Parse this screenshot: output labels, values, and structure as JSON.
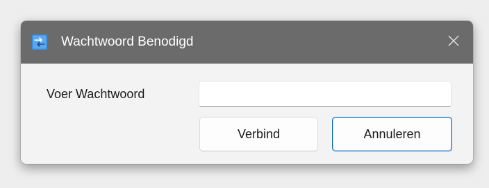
{
  "window": {
    "title": "Wachtwoord Benodigd",
    "icon": "network-connection-icon",
    "close_icon": "close-icon"
  },
  "form": {
    "password_label": "Voer Wachtwoord",
    "password_value": "",
    "password_placeholder": ""
  },
  "buttons": {
    "connect_label": "Verbind",
    "cancel_label": "Annuleren"
  },
  "colors": {
    "titlebar": "#6b6b6b",
    "accent": "#0067c0",
    "icon_blue": "#2f8fe0"
  }
}
